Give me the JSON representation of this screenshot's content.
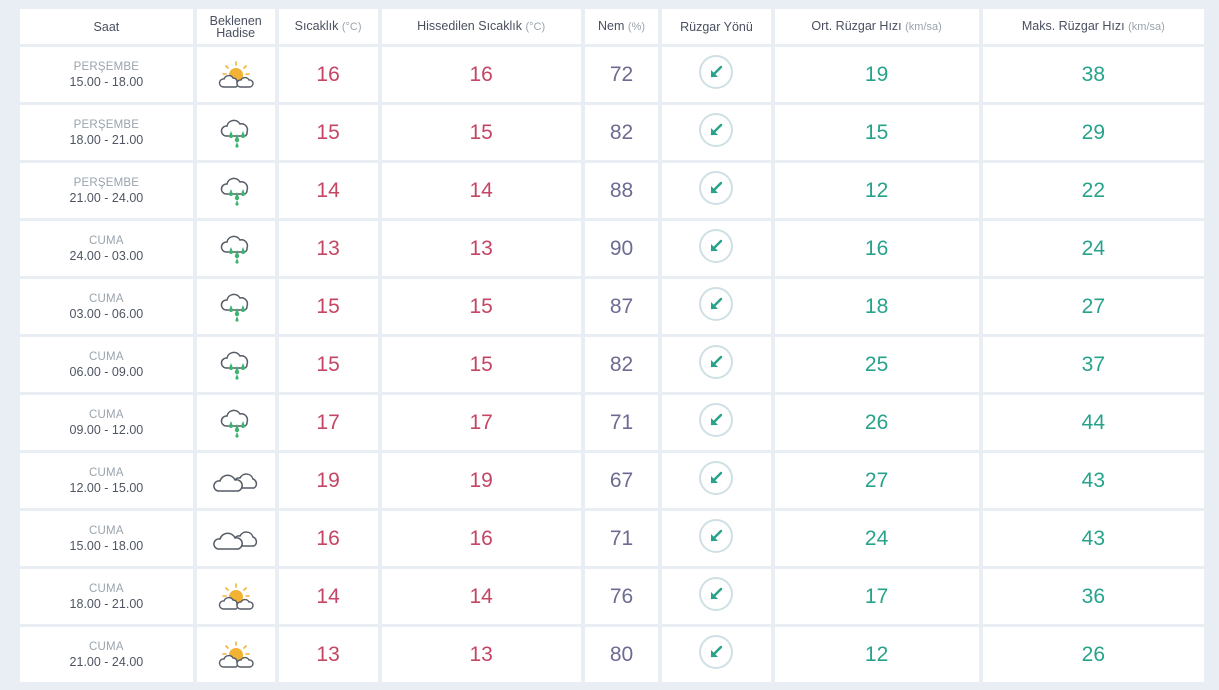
{
  "headers": {
    "saat": "Saat",
    "beklenen": "Beklenen",
    "hadise": "Hadise",
    "sicaklik": "Sıcaklık",
    "sicaklik_unit": "(°C)",
    "hissedilen": "Hissedilen Sıcaklık",
    "hissedilen_unit": "(°C)",
    "nem": "Nem",
    "nem_unit": "(%)",
    "ruzgar_yonu": "Rüzgar Yönü",
    "ort_ruzgar": "Ort. Rüzgar Hızı",
    "ort_ruzgar_unit": "(km/sa)",
    "maks_ruzgar": "Maks. Rüzgar Hızı",
    "maks_ruzgar_unit": "(km/sa)"
  },
  "rows": [
    {
      "day": "PERŞEMBE",
      "range": "15.00 - 18.00",
      "icon": "partly-cloudy-icon",
      "temp": "16",
      "feels": "16",
      "humidity": "72",
      "direction": "southwest-arrow-icon",
      "avg_wind": "19",
      "max_wind": "38"
    },
    {
      "day": "PERŞEMBE",
      "range": "18.00 - 21.00",
      "icon": "rain-cloud-icon",
      "temp": "15",
      "feels": "15",
      "humidity": "82",
      "direction": "southwest-arrow-icon",
      "avg_wind": "15",
      "max_wind": "29"
    },
    {
      "day": "PERŞEMBE",
      "range": "21.00 - 24.00",
      "icon": "rain-cloud-icon",
      "temp": "14",
      "feels": "14",
      "humidity": "88",
      "direction": "southwest-arrow-icon",
      "avg_wind": "12",
      "max_wind": "22"
    },
    {
      "day": "CUMA",
      "range": "24.00 - 03.00",
      "icon": "rain-cloud-icon",
      "temp": "13",
      "feels": "13",
      "humidity": "90",
      "direction": "southwest-arrow-icon",
      "avg_wind": "16",
      "max_wind": "24"
    },
    {
      "day": "CUMA",
      "range": "03.00 - 06.00",
      "icon": "rain-cloud-icon",
      "temp": "15",
      "feels": "15",
      "humidity": "87",
      "direction": "southwest-arrow-icon",
      "avg_wind": "18",
      "max_wind": "27"
    },
    {
      "day": "CUMA",
      "range": "06.00 - 09.00",
      "icon": "rain-cloud-icon",
      "temp": "15",
      "feels": "15",
      "humidity": "82",
      "direction": "southwest-arrow-icon",
      "avg_wind": "25",
      "max_wind": "37"
    },
    {
      "day": "CUMA",
      "range": "09.00 - 12.00",
      "icon": "rain-cloud-icon",
      "temp": "17",
      "feels": "17",
      "humidity": "71",
      "direction": "southwest-arrow-icon",
      "avg_wind": "26",
      "max_wind": "44"
    },
    {
      "day": "CUMA",
      "range": "12.00 - 15.00",
      "icon": "cloudy-icon",
      "temp": "19",
      "feels": "19",
      "humidity": "67",
      "direction": "southwest-arrow-icon",
      "avg_wind": "27",
      "max_wind": "43"
    },
    {
      "day": "CUMA",
      "range": "15.00 - 18.00",
      "icon": "cloudy-icon",
      "temp": "16",
      "feels": "16",
      "humidity": "71",
      "direction": "southwest-arrow-icon",
      "avg_wind": "24",
      "max_wind": "43"
    },
    {
      "day": "CUMA",
      "range": "18.00 - 21.00",
      "icon": "partly-cloudy-icon",
      "temp": "14",
      "feels": "14",
      "humidity": "76",
      "direction": "southwest-arrow-icon",
      "avg_wind": "17",
      "max_wind": "36"
    },
    {
      "day": "CUMA",
      "range": "21.00 - 24.00",
      "icon": "partly-cloudy-icon",
      "temp": "13",
      "feels": "13",
      "humidity": "80",
      "direction": "southwest-arrow-icon",
      "avg_wind": "12",
      "max_wind": "26"
    }
  ],
  "colors": {
    "temp": "#c44564",
    "humidity": "#6c6b92",
    "wind": "#27a38b",
    "sun": "#f2b233",
    "rain": "#3cb371",
    "cloud_stroke": "#555c66"
  }
}
